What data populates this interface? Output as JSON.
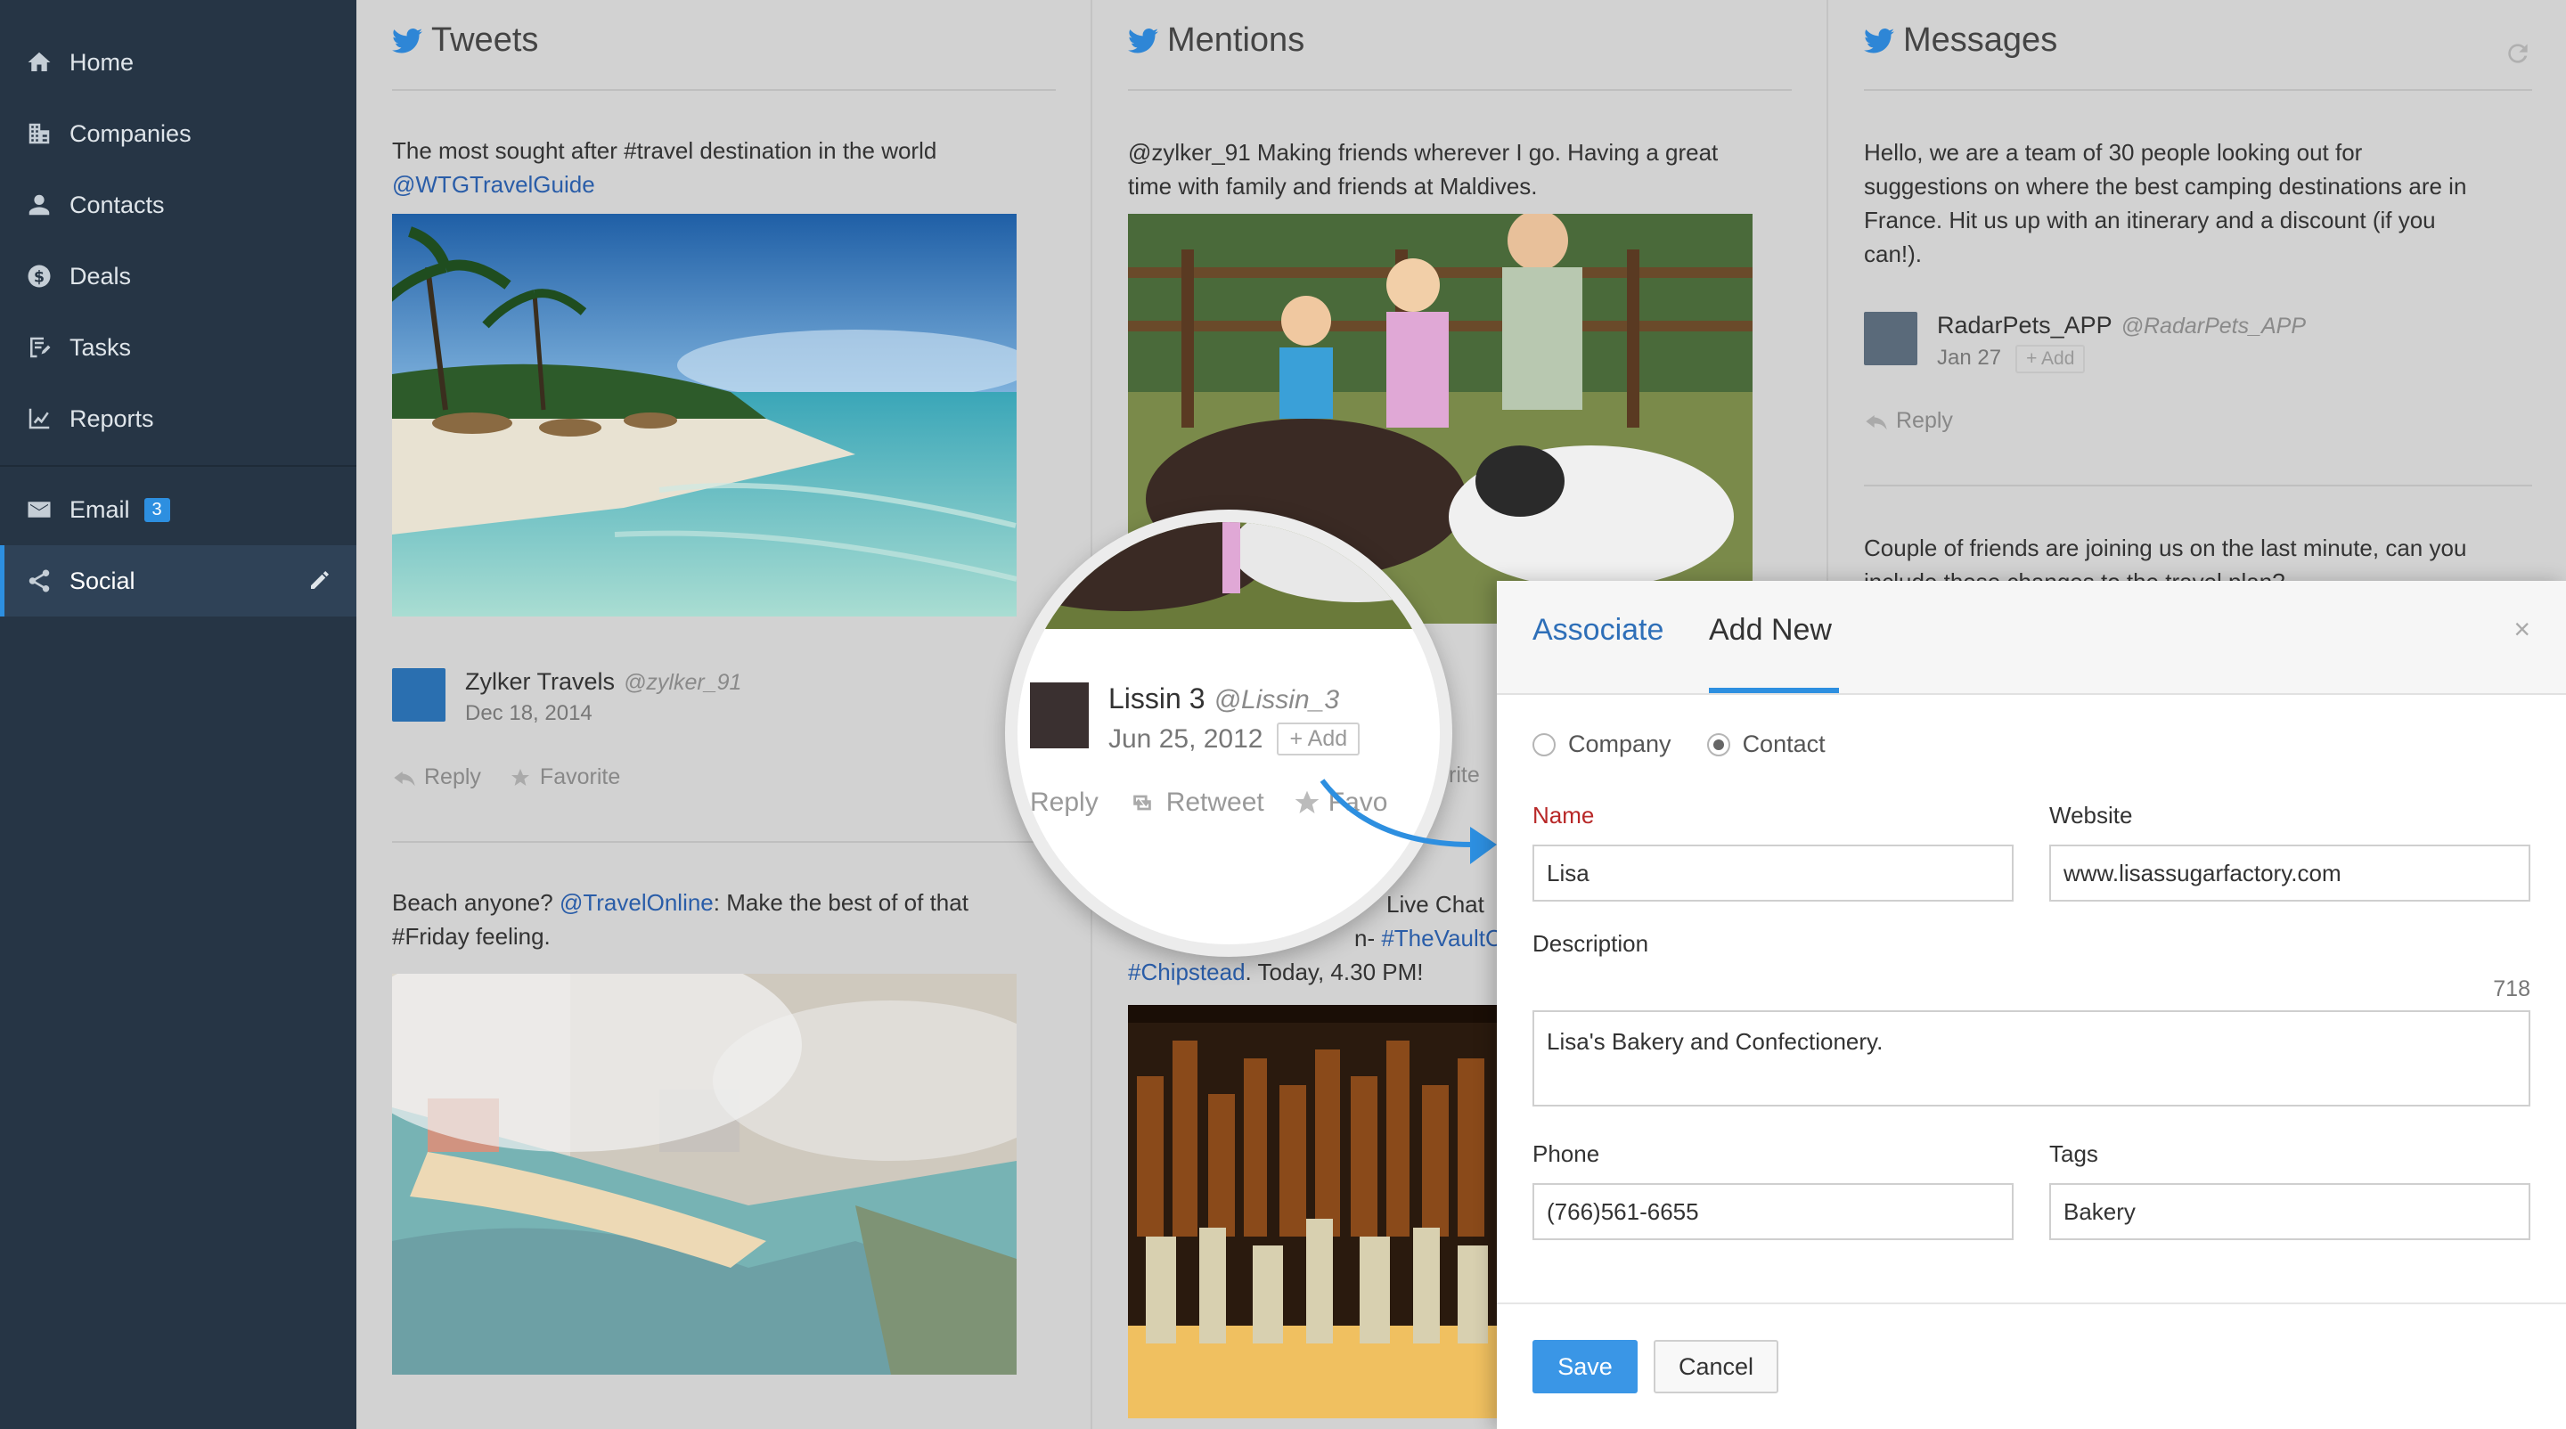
{
  "sidebar": {
    "items": [
      {
        "label": "Home",
        "icon": "home-icon"
      },
      {
        "label": "Companies",
        "icon": "building-icon"
      },
      {
        "label": "Contacts",
        "icon": "person-icon"
      },
      {
        "label": "Deals",
        "icon": "dollar-icon"
      },
      {
        "label": "Tasks",
        "icon": "task-icon"
      },
      {
        "label": "Reports",
        "icon": "chart-icon"
      },
      {
        "label": "Email",
        "icon": "mail-icon",
        "badge": "3"
      },
      {
        "label": "Social",
        "icon": "share-icon",
        "active": true
      }
    ]
  },
  "columns": {
    "tweets": {
      "title": "Tweets",
      "post1": {
        "text": "The most sought after #travel destination in the world",
        "link": "@WTGTravelGuide",
        "author": "Zylker Travels",
        "handle": "@zylker_91",
        "date": "Dec 18, 2014",
        "reply": "Reply",
        "favorite": "Favorite"
      },
      "post2": {
        "text_before": "Beach anyone? ",
        "link": "@TravelOnline",
        "text_after": ": Make the best of of that",
        "text_line2": "#Friday feeling."
      }
    },
    "mentions": {
      "title": "Mentions",
      "post1": {
        "text_line1": "@zylker_91 Making friends wherever I go. Having a great",
        "text_line2": "time with family and friends at Maldives.",
        "fav_partial": "rite"
      },
      "post2": {
        "line1_partial": "Live Chat",
        "line2_prefix": "n- ",
        "line2_link": "#TheVaultC",
        "line3_link": "#Chipstead",
        "line3_rest": ". Today, 4.30 PM!"
      }
    },
    "messages": {
      "title": "Messages",
      "post1": {
        "line1": "Hello, we are a team of 30 people looking out for",
        "line2": "suggestions on where the best camping destinations are in",
        "line3": "France. Hit us up with an itinerary and a discount (if you",
        "line4": "can!).",
        "author": "RadarPets_APP",
        "handle": "@RadarPets_APP",
        "date": "Jan 27",
        "add": "+ Add",
        "reply": "Reply"
      },
      "post2": {
        "line1": "Couple of friends are joining us on the last minute, can you",
        "line2": "include these changes to the travel plan?"
      }
    }
  },
  "magnifier": {
    "author": "Lissin 3",
    "handle": "@Lissin_3",
    "date": "Jun 25, 2012",
    "add": "+ Add",
    "reply": "Reply",
    "retweet": "Retweet",
    "favorite": "Favo"
  },
  "modal": {
    "tabs": [
      "Associate",
      "Add New"
    ],
    "active_tab": "Add New",
    "radio": {
      "company": "Company",
      "contact": "Contact",
      "selected": "Contact"
    },
    "name": {
      "label": "Name",
      "value": "Lisa"
    },
    "website": {
      "label": "Website",
      "value": "www.lisassugarfactory.com"
    },
    "description": {
      "label": "Description",
      "counter": "718",
      "value": "Lisa's Bakery and Confectionery."
    },
    "phone": {
      "label": "Phone",
      "value": "(766)561-6655"
    },
    "tags": {
      "label": "Tags",
      "value": "Bakery"
    },
    "save": "Save",
    "cancel": "Cancel",
    "close": "×"
  },
  "colors": {
    "accent": "#2d8fe0",
    "sidebar": "#263545",
    "required": "#b82828"
  }
}
